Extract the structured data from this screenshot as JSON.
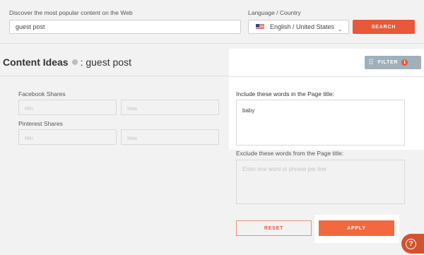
{
  "search": {
    "label": "Discover the most popular content on the Web",
    "value": "guest post",
    "button_label": "SEARCH"
  },
  "language": {
    "label": "Language / Country",
    "selected": "English / United States",
    "flag_icon": "us-flag-icon"
  },
  "content": {
    "title_bold": "Content Ideas",
    "title_query": ": guest post"
  },
  "filters": {
    "facebook_label": "Facebook Shares",
    "pinterest_label": "Pinterest Shares",
    "min_placeholder": "Min",
    "max_placeholder": "Max"
  },
  "panel": {
    "filter_button": "FILTER",
    "filter_count": "1",
    "include_label": "Include these words in the Page title:",
    "include_value": "baby",
    "exclude_label": "Exclude these words from the Page title:",
    "exclude_placeholder": "Enter one word or phrase per line"
  },
  "actions": {
    "reset_label": "RESET",
    "apply_label": "APPLY"
  },
  "help": {
    "icon": "?"
  },
  "colors": {
    "accent": "#e8583a",
    "filter_button": "#9fb0ba"
  }
}
